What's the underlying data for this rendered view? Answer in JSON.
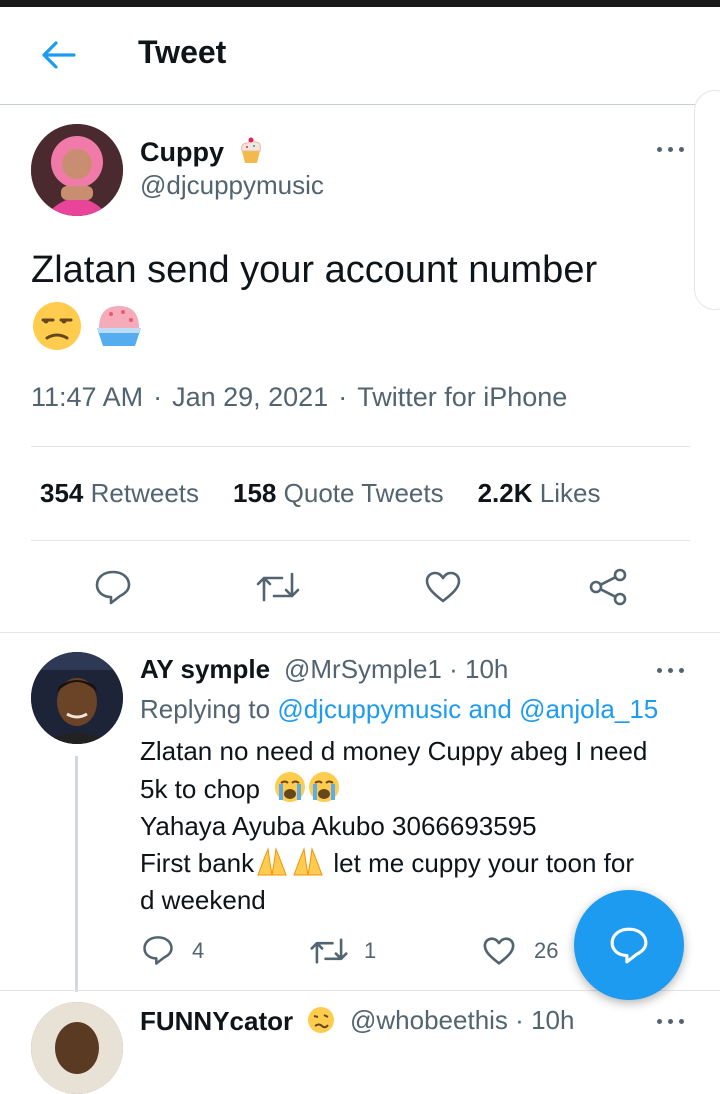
{
  "header": {
    "title": "Tweet"
  },
  "tweet": {
    "author_name": "Cuppy",
    "author_handle": "@djcuppymusic",
    "text": "Zlatan send your account number",
    "time": "11:47 AM",
    "date": "Jan 29, 2021",
    "source": "Twitter for iPhone",
    "separator": "·",
    "stats": {
      "retweets_count": "354",
      "retweets_label": "Retweets",
      "quotes_count": "158",
      "quotes_label": "Quote Tweets",
      "likes_count": "2.2K",
      "likes_label": "Likes"
    }
  },
  "reply": {
    "author_name": "AY symple",
    "author_handle": "@MrSymple1",
    "time": "10h",
    "replying_label": "Replying to",
    "replying_user_1": "@djcuppymusic",
    "replying_and": "and",
    "replying_user_2": "@anjola_15",
    "line1": "Zlatan no need d money Cuppy abeg I need",
    "line2": "5k to chop",
    "line3": "Yahaya Ayuba Akubo 3066693595",
    "line4_a": "First bank",
    "line4_b": "let me cuppy your toon for",
    "line5": "d weekend",
    "reply_count": "4",
    "retweet_count": "1",
    "like_count": "26"
  },
  "next_reply": {
    "author_name": "FUNNYcator",
    "author_handle": "@whobeethis",
    "time": "10h"
  },
  "colors": {
    "accent": "#1d9bf0",
    "text": "#0f1419",
    "muted": "#536471",
    "divider": "#e1e6ea"
  },
  "icons": [
    "back-arrow-icon",
    "more-icon",
    "reply-icon",
    "retweet-icon",
    "like-icon",
    "share-icon",
    "compose-reply-icon"
  ]
}
